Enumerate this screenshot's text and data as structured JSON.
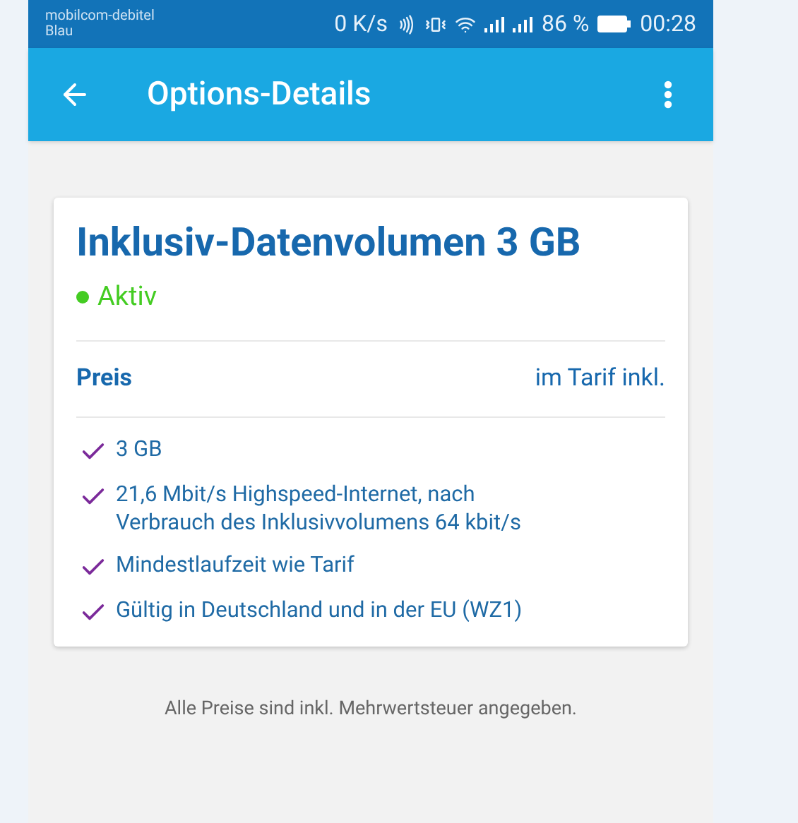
{
  "status_bar": {
    "carrier": [
      "mobilcom-debitel",
      "Blau"
    ],
    "speed": "0 K/s",
    "battery": "86 %",
    "time": "00:28"
  },
  "app_bar": {
    "title": "Options-Details"
  },
  "option": {
    "title": "Inklusiv-Datenvolumen 3 GB",
    "status": {
      "label": "Aktiv",
      "color": "#44cc22"
    },
    "price": {
      "label": "Preis",
      "value": "im Tarif inkl."
    },
    "features": [
      "3 GB",
      "21,6 Mbit/s Highspeed-Internet, nach Verbrauch des Inklusivvolumens 64 kbit/s",
      "Mindestlaufzeit wie Tarif",
      "Gültig in Deutschland und in der EU (WZ1)"
    ]
  },
  "footer": "Alle Preise sind inkl. Mehrwertsteuer angegeben."
}
